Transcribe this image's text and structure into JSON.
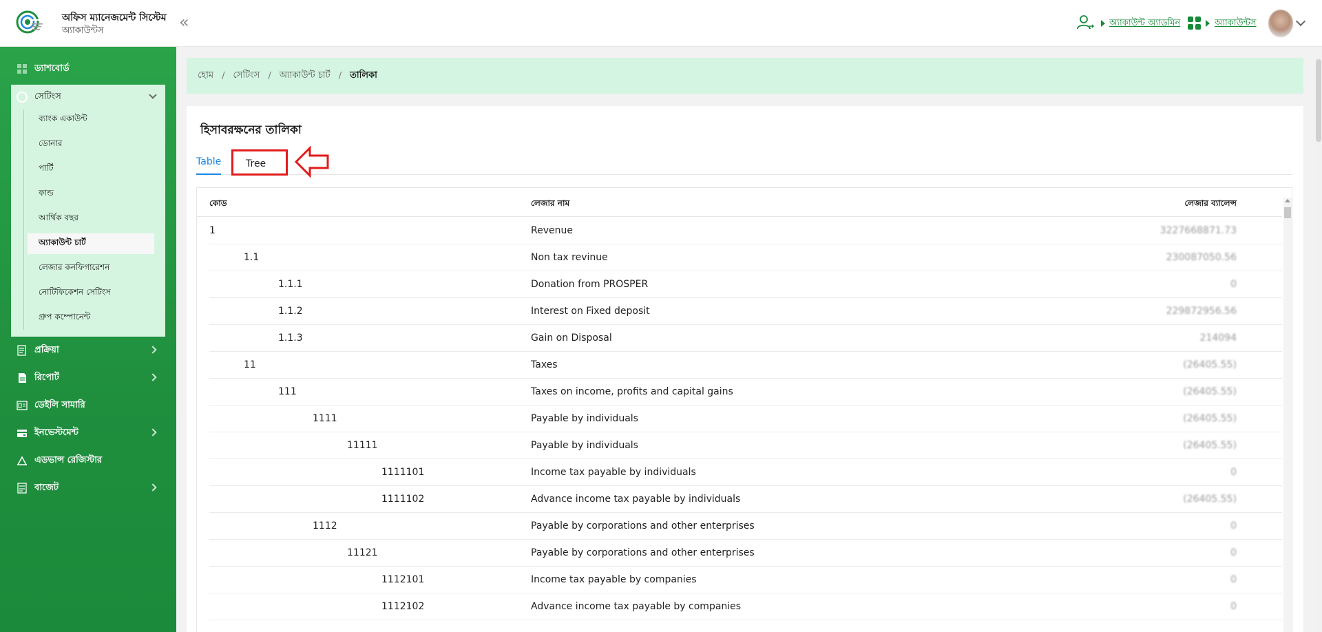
{
  "header": {
    "app_title": "অফিস ম্যানেজমেন্ট সিস্টেম",
    "app_subtitle": "অ্যাকাউন্টস",
    "account_admin_label": "অ্যাকাউন্ট অ্যাডমিন",
    "accounts_label": "অ্যাকাউন্টস"
  },
  "sidebar": {
    "items": [
      {
        "label": "ড্যাশবোর্ড",
        "icon": "dashboard-icon"
      },
      {
        "label": "প্রক্রিয়া",
        "icon": "process-icon"
      },
      {
        "label": "রিপোর্ট",
        "icon": "report-icon"
      },
      {
        "label": "ডেইলি সামারি",
        "icon": "daily-summary-icon"
      },
      {
        "label": "ইনভেস্টমেন্ট",
        "icon": "investment-icon"
      },
      {
        "label": "এডভান্স রেজিস্টার",
        "icon": "advance-register-icon"
      },
      {
        "label": "বাজেট",
        "icon": "budget-icon"
      }
    ],
    "settings": {
      "label": "সেটিংস",
      "items": [
        {
          "label": "ব্যাংক একাউন্ট"
        },
        {
          "label": "ডোনার"
        },
        {
          "label": "পার্টি"
        },
        {
          "label": "ফান্ড"
        },
        {
          "label": "আর্থিক বছর"
        },
        {
          "label": "অ্যাকাউন্ট চার্ট",
          "active": true
        },
        {
          "label": "লেজার কনফিগারেশন"
        },
        {
          "label": "নোটিফিকেশন সেটিংস"
        },
        {
          "label": "গ্রুপ কম্পোনেন্ট"
        }
      ]
    }
  },
  "breadcrumb": {
    "items": [
      "হোম",
      "সেটিংস",
      "অ্যাকাউন্ট চার্ট",
      "তালিকা"
    ]
  },
  "page": {
    "title": "হিসাবরক্ষনের তালিকা",
    "tabs": [
      {
        "label": "Table",
        "active": true
      },
      {
        "label": "Tree",
        "active": false
      }
    ]
  },
  "table": {
    "columns": {
      "code": "কোড",
      "name": "লেজার নাম",
      "balance": "লেজার ব্যালেন্স"
    },
    "rows": [
      {
        "code": "1",
        "level": 0,
        "name": "Revenue",
        "balance": "3227668871.73"
      },
      {
        "code": "1.1",
        "level": 1,
        "name": "Non tax revinue",
        "balance": "230087050.56"
      },
      {
        "code": "1.1.1",
        "level": 2,
        "name": "Donation from PROSPER",
        "balance": "0"
      },
      {
        "code": "1.1.2",
        "level": 2,
        "name": "Interest on Fixed deposit",
        "balance": "229872956.56"
      },
      {
        "code": "1.1.3",
        "level": 2,
        "name": "Gain on Disposal",
        "balance": "214094"
      },
      {
        "code": "11",
        "level": 1,
        "name": "Taxes",
        "balance": "(26405.55)"
      },
      {
        "code": "111",
        "level": 2,
        "name": "Taxes on income, profits and capital gains",
        "balance": "(26405.55)"
      },
      {
        "code": "1111",
        "level": 3,
        "name": "Payable by individuals",
        "balance": "(26405.55)"
      },
      {
        "code": "11111",
        "level": 4,
        "name": "Payable by individuals",
        "balance": "(26405.55)"
      },
      {
        "code": "1111101",
        "level": 5,
        "name": "Income tax payable by individuals",
        "balance": "0"
      },
      {
        "code": "1111102",
        "level": 5,
        "name": "Advance income tax payable by individuals",
        "balance": "(26405.55)"
      },
      {
        "code": "1112",
        "level": 3,
        "name": "Payable by corporations and other enterprises",
        "balance": "0"
      },
      {
        "code": "11121",
        "level": 4,
        "name": "Payable by corporations and other enterprises",
        "balance": "0"
      },
      {
        "code": "1112101",
        "level": 5,
        "name": "Income tax payable by companies",
        "balance": "0"
      },
      {
        "code": "1112102",
        "level": 5,
        "name": "Advance income tax payable by companies",
        "balance": "0"
      }
    ]
  },
  "colors": {
    "brand_green": "#1f8f3e",
    "accent_blue": "#1b87e6",
    "annotation_red": "#e11b1b",
    "panel_mint": "#d4f5e2"
  }
}
